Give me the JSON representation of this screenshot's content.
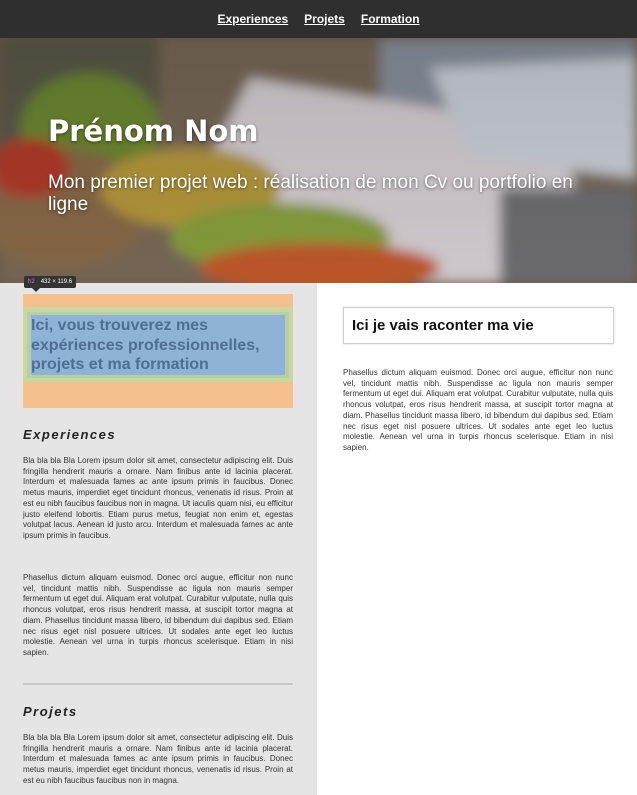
{
  "nav": {
    "items": [
      {
        "label": "Experiences"
      },
      {
        "label": "Projets"
      },
      {
        "label": "Formation"
      }
    ]
  },
  "hero": {
    "name": "Prénom Nom",
    "subtitle": "Mon premier projet web : réalisation de mon Cv ou portfolio en ligne"
  },
  "devtools_badge": {
    "tag": "h2",
    "size": "432 × 119.6"
  },
  "left": {
    "intro_heading": "Ici, vous trouverez mes expériences professionnelles, projets et ma formation",
    "experiences": {
      "title": "Experiences",
      "para1": "Bla bla bla Bla Lorem ipsum dolor sit amet, consectetur adipiscing elit. Duis fringilla hendrerit mauris a ornare. Nam finibus ante id lacinia placerat. Interdum et malesuada fames ac ante ipsum primis in faucibus. Donec metus mauris, imperdiet eget tincidunt rhoncus, venenatis id risus. Proin at est eu nibh faucibus faucibus non in magna. Ut iaculis quam nisi, eu efficitur justo eleifend lobortis. Etiam purus metus, feugiat non enim et, egestas volutpat lacus. Aenean id justo arcu. Interdum et malesuada fames ac ante ipsum primis in faucibus.",
      "para2": "Phasellus dictum aliquam euismod. Donec orci augue, efficitur non nunc vel, tincidunt mattis nibh. Suspendisse ac ligula non mauris semper fermentum ut eget dui. Aliquam erat volutpat. Curabitur vulputate, nulla quis rhoncus volutpat, eros risus hendrerit massa, at suscipit tortor magna at diam. Phasellus tincidunt massa libero, id bibendum dui dapibus sed. Etiam nec risus eget nisl posuere ultrices. Ut sodales ante eget leo luctus molestie. Aenean vel urna in turpis rhoncus scelerisque. Etiam in nisi sapien."
    },
    "projets": {
      "title": "Projets",
      "para1": "Bla bla bla Bla Lorem ipsum dolor sit amet, consectetur adipiscing elit. Duis fringilla hendrerit mauris a ornare. Nam finibus ante id lacinia placerat. Interdum et malesuada fames ac ante ipsum primis in faucibus. Donec metus mauris, imperdiet eget tincidunt rhoncus, venenatis id risus. Proin at est eu nibh faucibus faucibus non in magna."
    }
  },
  "right": {
    "heading": "Ici je vais raconter ma vie",
    "para": "Phasellus dictum aliquam euismod. Donec orci augue, efficitur non nunc vel, tincidunt mattis nibh. Suspendisse ac ligula non mauris semper fermentum ut eget dui. Aliquam erat volutpat. Curabitur vulputate, nulla quis rhoncus volutpat, eros risus hendrerit massa, at suscipit tortor magna at diam. Phasellus tincidunt massa libero, id bibendum dui dapibus sed. Etiam nec risus eget nisl posuere ultrices. Ut sodales ante eget leo luctus molestie. Aenean vel urna in turpis rhoncus scelerisque. Etiam in nisi sapien."
  },
  "colors": {
    "nav_bg": "#2f2f2f",
    "left_bg": "#e5e5e5",
    "devtools_margin": "#f3c08e",
    "devtools_content": "#8fb3d6",
    "intro_heading": "#4e6e94"
  }
}
